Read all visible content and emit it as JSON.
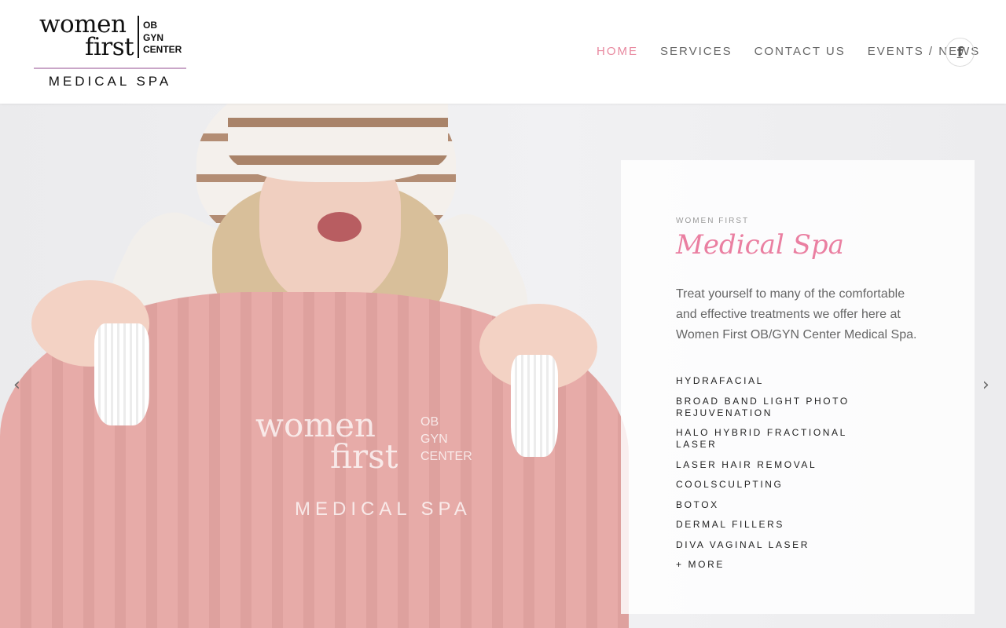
{
  "logo": {
    "line1": "women",
    "line2": "first",
    "ob": "OB",
    "gyn": "GYN",
    "center": "CENTER",
    "tagline": "MEDICAL SPA"
  },
  "nav": {
    "items": [
      {
        "label": "HOME",
        "active": true
      },
      {
        "label": "SERVICES",
        "active": false
      },
      {
        "label": "CONTACT US",
        "active": false
      },
      {
        "label": "EVENTS / NEWS",
        "active": false
      }
    ],
    "social_icon": "facebook-icon",
    "social_glyph": "f"
  },
  "hero": {
    "prev_glyph": "‹",
    "next_glyph": "›",
    "shirt_logo": {
      "line1": "women",
      "line2": "first",
      "ob": "OB",
      "gyn": "GYN",
      "center": "CENTER",
      "tagline": "MEDICAL SPA"
    }
  },
  "card": {
    "eyebrow": "WOMEN FIRST",
    "title": "Medical Spa",
    "description": "Treat yourself to many of the comfortable and effective treatments we offer here at Women First OB/GYN Center Medical Spa.",
    "services": [
      "HYDRAFACIAL",
      "BROAD BAND LIGHT PHOTO REJUVENATION",
      "HALO HYBRID FRACTIONAL LASER",
      "LASER HAIR REMOVAL",
      "COOLSCULPTING",
      "BOTOX",
      "DERMAL FILLERS",
      "DIVA VAGINAL LASER",
      "+ MORE"
    ]
  },
  "colors": {
    "accent_pink": "#ea7fa1",
    "nav_active": "#e8899f",
    "logo_rule": "#c9a6c8"
  }
}
